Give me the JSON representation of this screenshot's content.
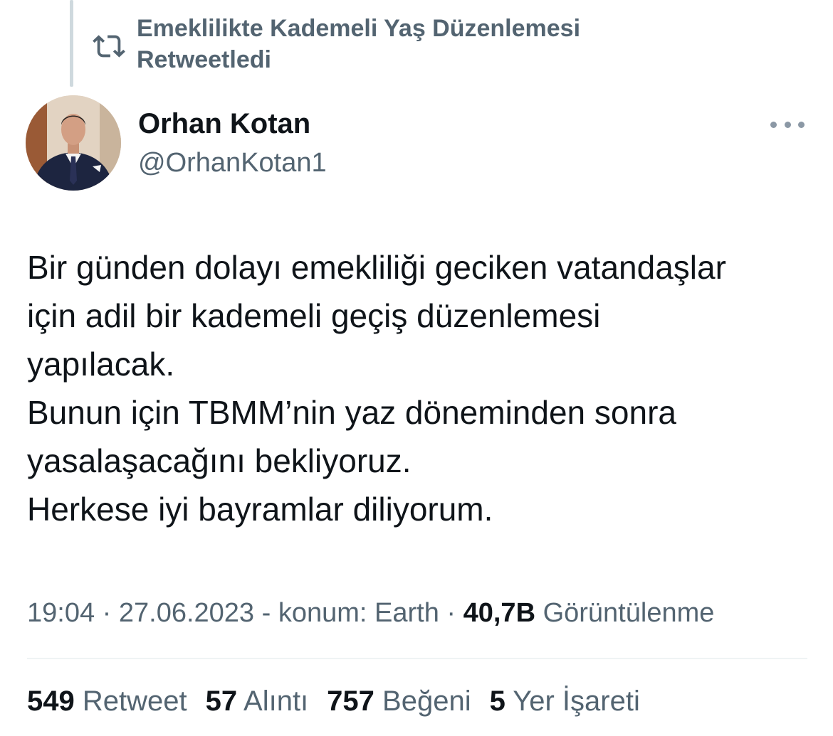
{
  "retweet_banner": {
    "line1": "Emeklilikte Kademeli Yaş Düzenlemesi",
    "line2": "Retweetledi",
    "icon": "retweet-icon"
  },
  "author": {
    "name": "Orhan Kotan",
    "handle": "@OrhanKotan1"
  },
  "tweet": {
    "lines": [
      "Bir günden dolayı emekliliği geciken vatandaşlar",
      "için adil bir kademeli geçiş düzenlemesi",
      "yapılacak.",
      "Bunun için TBMM’nin yaz döneminden sonra",
      "yasalaşacağını bekliyoruz.",
      "Herkese iyi bayramlar diliyorum."
    ]
  },
  "meta": {
    "time": "19:04",
    "sep1": " · ",
    "date": "27.06.2023",
    "location": " - konum: Earth",
    "sep2": " · ",
    "views_count": "40,7B",
    "views_label": " Görüntülenme"
  },
  "stats": {
    "retweets_count": "549",
    "retweets_label": " Retweet",
    "quotes_count": "57",
    "quotes_label": " Alıntı",
    "likes_count": "757",
    "likes_label": " Beğeni",
    "bookmarks_count": "5",
    "bookmarks_label": " Yer İşareti"
  },
  "colors": {
    "primary_text": "#0f1419",
    "secondary_text": "#536471",
    "divider": "#eff3f4"
  }
}
